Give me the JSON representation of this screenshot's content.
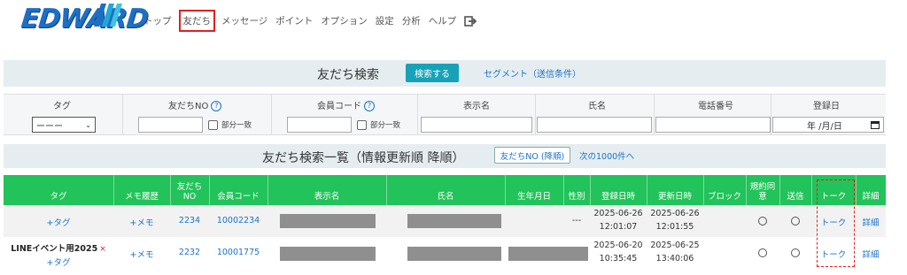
{
  "header": {
    "logo": "EDWARD",
    "nav": [
      "トップ",
      "友だち",
      "メッセージ",
      "ポイント",
      "オプション",
      "設定",
      "分析",
      "ヘルプ"
    ],
    "active_nav": "友だち"
  },
  "search": {
    "title": "友だち検索",
    "search_button": "検索する",
    "segment_link": "セグメント（送信条件）",
    "columns": [
      "タグ",
      "友だちNO",
      "会員コード",
      "表示名",
      "氏名",
      "電話番号",
      "登録日"
    ],
    "tag_select": "ーーー",
    "partial_match": "部分一致",
    "date_placeholder": "年 /月/日"
  },
  "list": {
    "title": "友だち検索一覧（情報更新順 降順）",
    "sort_button": "友だちNO (降順)",
    "next_link": "次の1000件へ",
    "columns": [
      "タグ",
      "メモ履歴",
      "友だち\nNO",
      "会員コード",
      "表示名",
      "氏名",
      "生年月日",
      "性別",
      "登録日時",
      "更新日時",
      "ブロック",
      "規約同\n意",
      "送信",
      "トーク",
      "詳細"
    ],
    "rows": [
      {
        "tag_name": "",
        "tag_link": "+タグ",
        "memo": "+メモ",
        "friend_no": "2234",
        "member_code": "10002234",
        "birthday": "",
        "gender": "---",
        "registered_date": "2025-06-26",
        "registered_time": "12:01:07",
        "updated_date": "2025-06-26",
        "updated_time": "12:01:55",
        "talk": "トーク",
        "detail": "詳細"
      },
      {
        "tag_name": "LINEイベント用2025",
        "tag_remove": "×",
        "tag_link": "+タグ",
        "memo": "+メモ",
        "friend_no": "2232",
        "member_code": "10001775",
        "birthday": "",
        "gender": "",
        "registered_date": "2025-06-20",
        "registered_time": "10:35:45",
        "updated_date": "2025-06-25",
        "updated_time": "13:40:06",
        "talk": "トーク",
        "detail": "詳細"
      }
    ]
  },
  "colors": {
    "accent": "#17a2b8",
    "table_header": "#22c35a",
    "link": "#1a73c9",
    "highlight": "#e02020"
  }
}
